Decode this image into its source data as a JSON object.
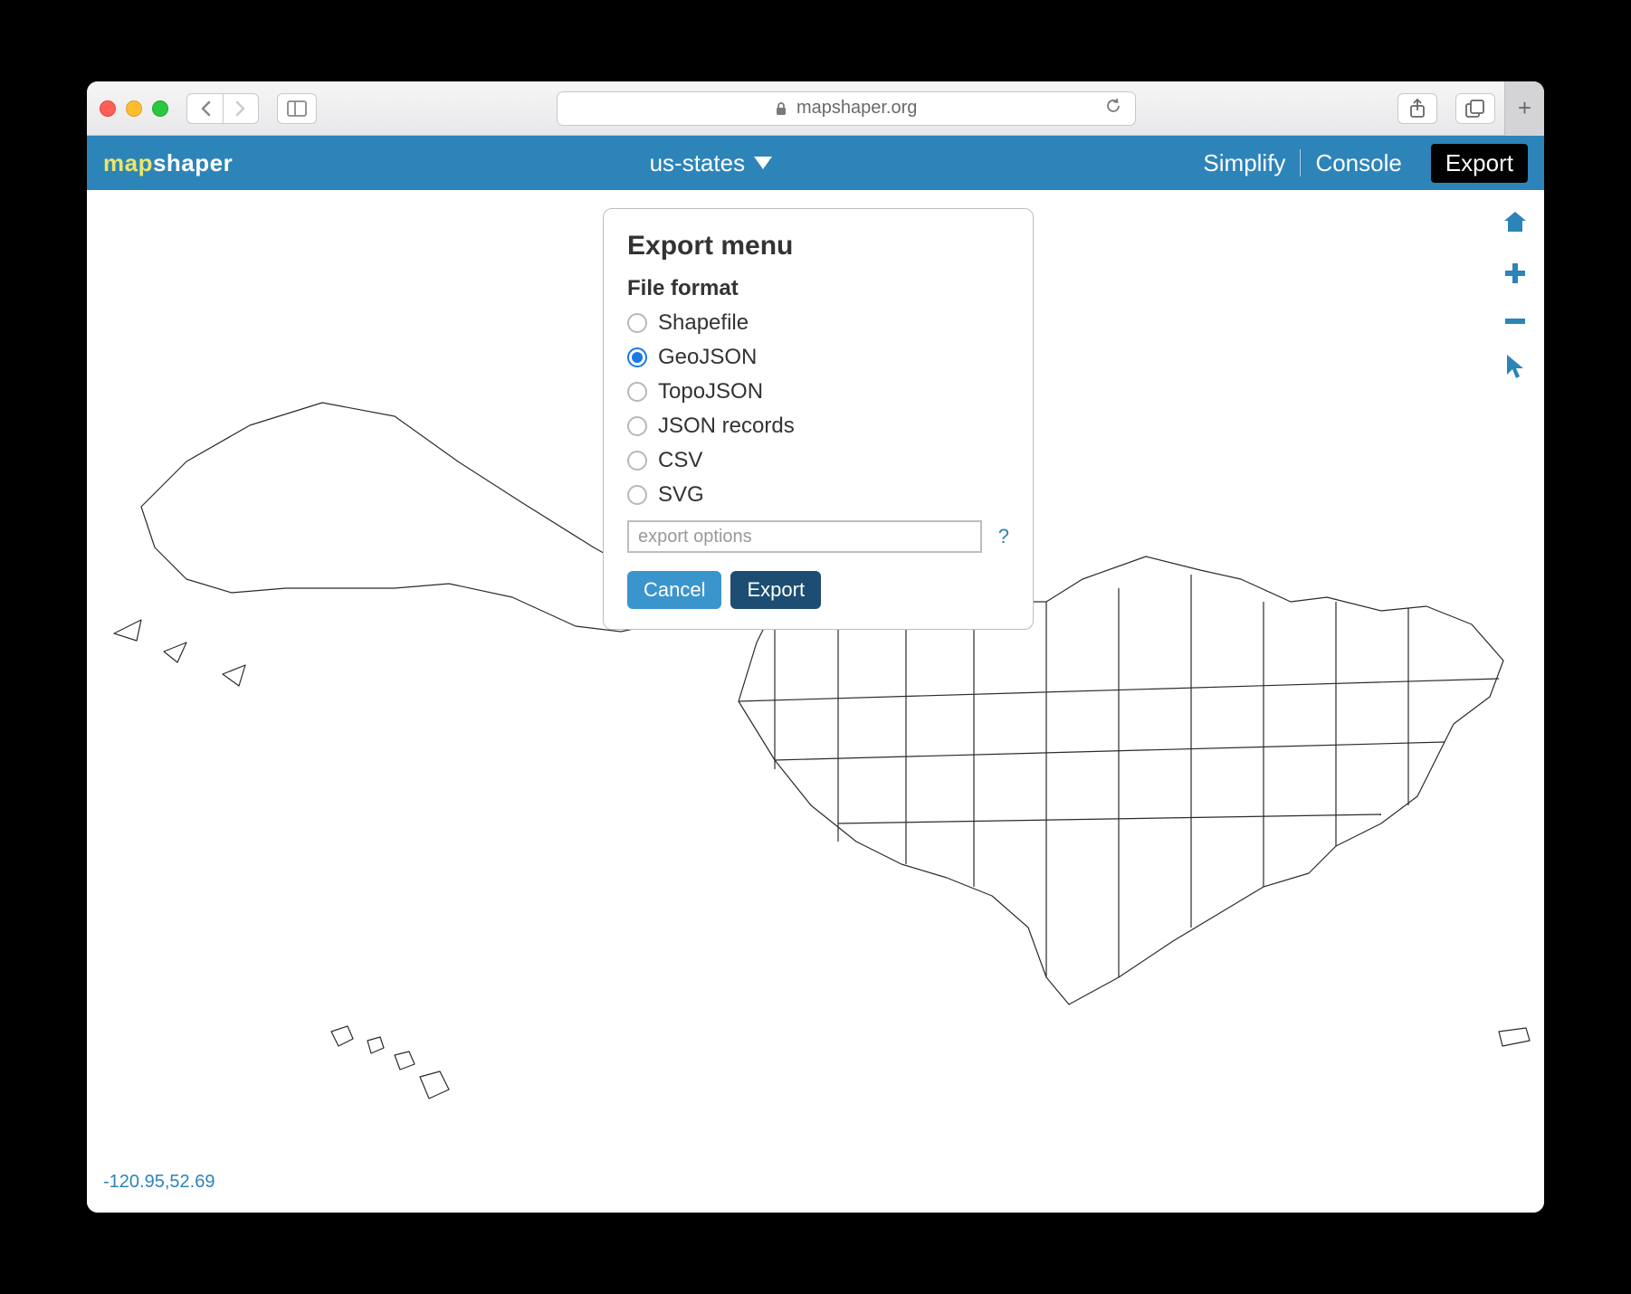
{
  "browser": {
    "url": "mapshaper.org"
  },
  "app": {
    "logo_map": "map",
    "logo_shaper": "shaper",
    "layer": "us-states",
    "nav": {
      "simplify": "Simplify",
      "console": "Console",
      "export": "Export"
    }
  },
  "modal": {
    "title": "Export menu",
    "format_label": "File format",
    "formats": [
      {
        "label": "Shapefile",
        "checked": false
      },
      {
        "label": "GeoJSON",
        "checked": true
      },
      {
        "label": "TopoJSON",
        "checked": false
      },
      {
        "label": "JSON records",
        "checked": false
      },
      {
        "label": "CSV",
        "checked": false
      },
      {
        "label": "SVG",
        "checked": false
      }
    ],
    "options_placeholder": "export options",
    "help_symbol": "?",
    "cancel": "Cancel",
    "export": "Export"
  },
  "status": {
    "coordinates": "-120.95,52.69"
  }
}
